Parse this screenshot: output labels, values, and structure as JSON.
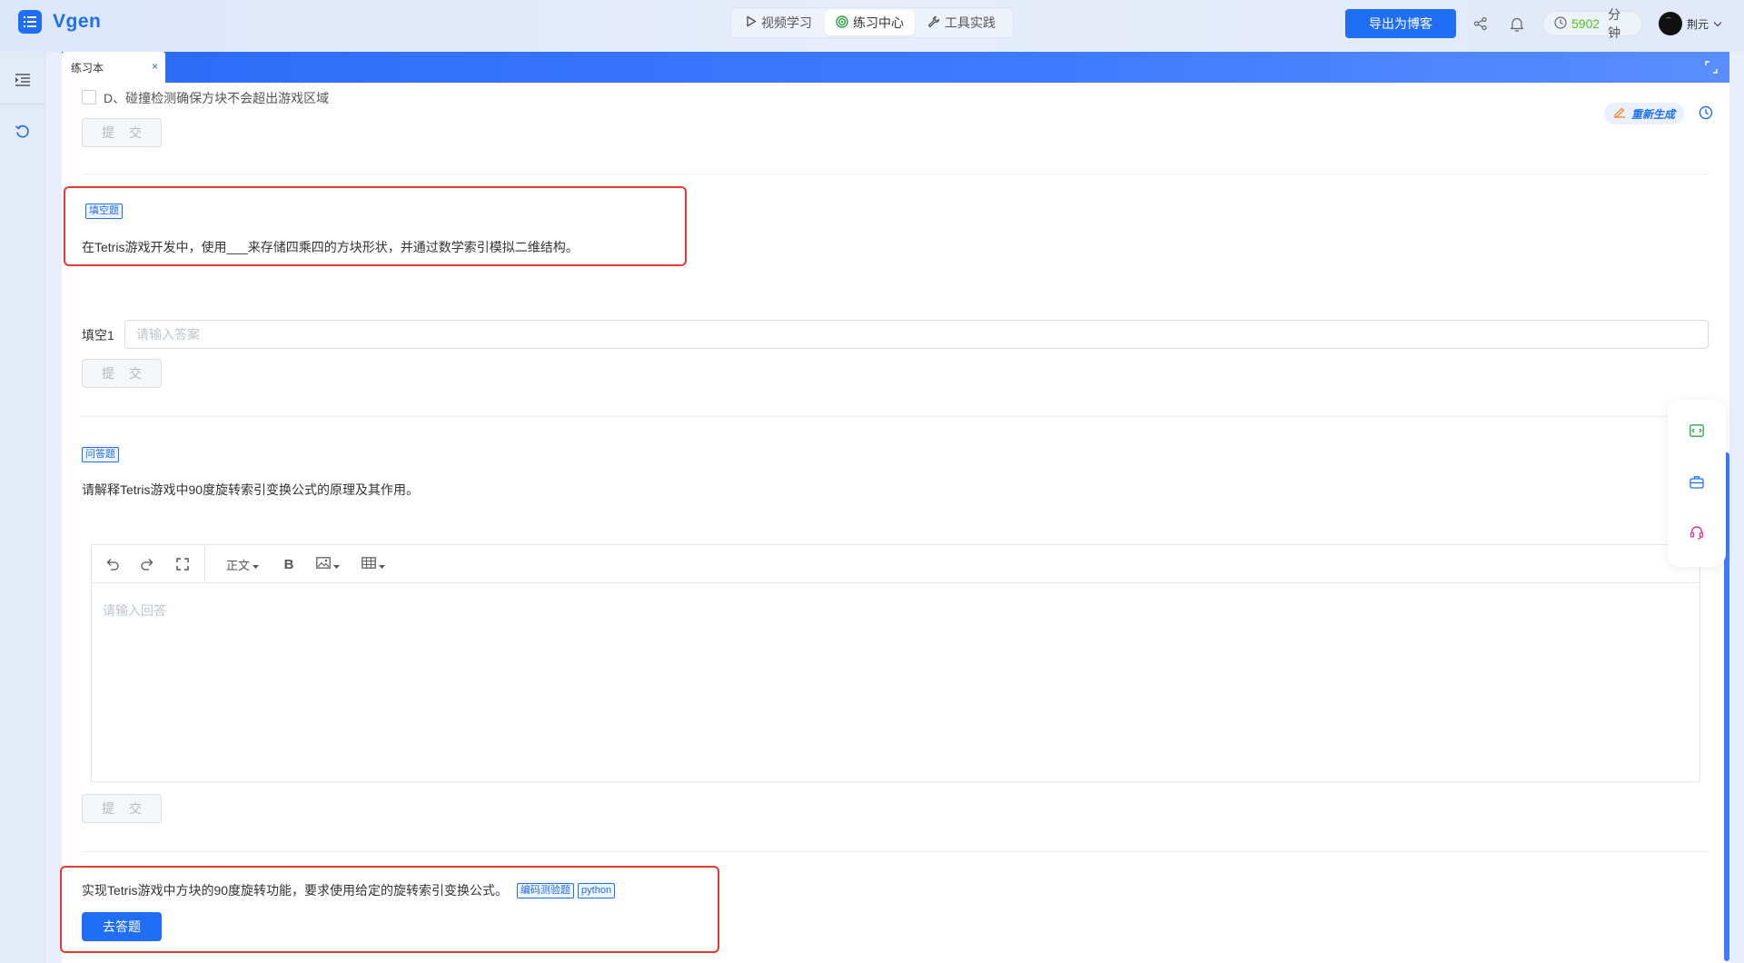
{
  "app": {
    "title": "Vgen"
  },
  "nav": {
    "tabs": [
      {
        "label": "视频学习",
        "icon": "play-icon"
      },
      {
        "label": "练习中心",
        "icon": "target-icon"
      },
      {
        "label": "工具实践",
        "icon": "wrench-icon"
      }
    ],
    "active_tab": "练习中心"
  },
  "header": {
    "export_label": "导出为博客",
    "minutes_value": "5902",
    "minutes_unit": "分钟",
    "user_name": "荆元"
  },
  "panel": {
    "tab_label": "练习本",
    "close_glyph": "×",
    "regenerate_label": "重新生成"
  },
  "questions": {
    "mc": {
      "option_d": "D、碰撞检测确保方块不会超出游戏区域",
      "submit_label": "提 交"
    },
    "fill": {
      "tag": "填空题",
      "text": "在Tetris游戏开发中，使用___来存储四乘四的方块形状，并通过数学索引模拟二维结构。",
      "blank_label": "填空1",
      "placeholder": "请输入答案",
      "submit_label": "提 交"
    },
    "qa": {
      "tag": "问答题",
      "text": "请解释Tetris游戏中90度旋转索引变换公式的原理及其作用。",
      "editor": {
        "format_label": "正文",
        "bold_label": "B",
        "placeholder": "请输入回答"
      },
      "submit_label": "提 交"
    },
    "coding": {
      "text": "实现Tetris游戏中方块的90度旋转功能，要求使用给定的旋转索引变换公式。",
      "tags": [
        "编码测验题",
        "python"
      ],
      "go_label": "去答题"
    }
  },
  "colors": {
    "accent": "#1f6ef3",
    "highlight_border": "#e53a2f",
    "minutes": "#52c41a"
  }
}
